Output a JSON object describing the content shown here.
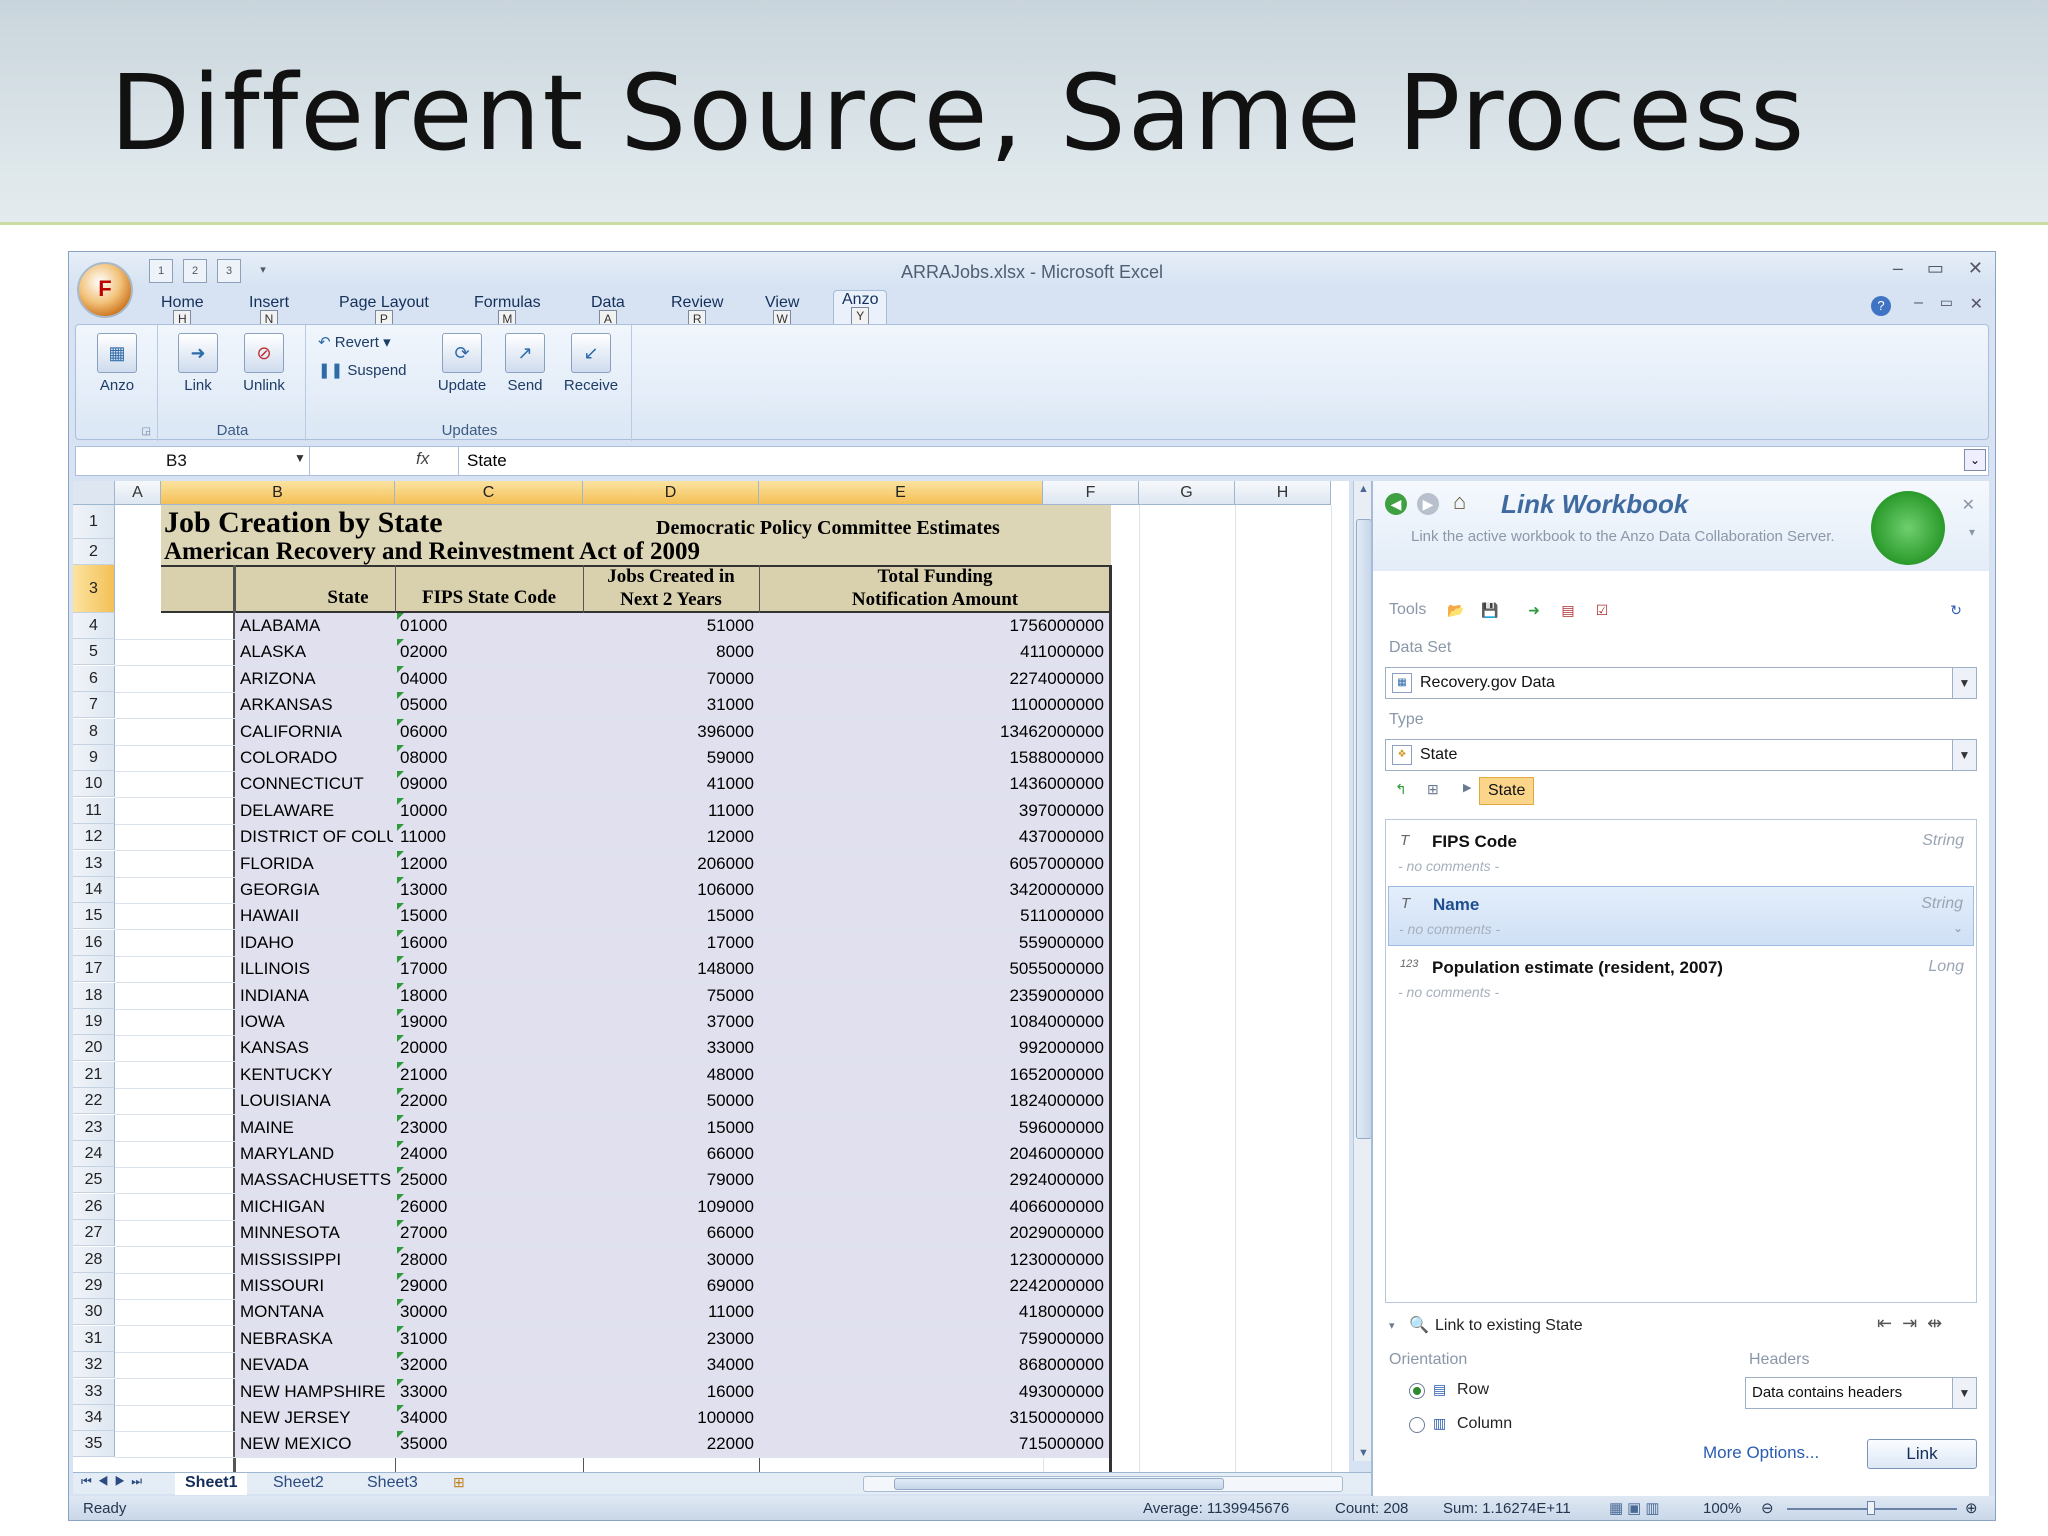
{
  "slide": {
    "title": "Different Source, Same Process"
  },
  "window": {
    "title": "ARRAJobs.xlsx - Microsoft Excel",
    "office_button": "F"
  },
  "qat": {
    "k1": "1",
    "k2": "2",
    "k3": "3"
  },
  "tabs": [
    {
      "label": "Home",
      "key": "H"
    },
    {
      "label": "Insert",
      "key": "N"
    },
    {
      "label": "Page Layout",
      "key": "P"
    },
    {
      "label": "Formulas",
      "key": "M"
    },
    {
      "label": "Data",
      "key": "A"
    },
    {
      "label": "Review",
      "key": "R"
    },
    {
      "label": "View",
      "key": "W"
    },
    {
      "label": "Anzo",
      "key": "Y"
    }
  ],
  "ribbon": {
    "anzo": "Anzo",
    "link": "Link",
    "unlink": "Unlink",
    "data_group": "Data",
    "revert": "Revert",
    "suspend": "Suspend",
    "update": "Update",
    "send": "Send",
    "receive": "Receive",
    "updates_group": "Updates"
  },
  "formula": {
    "namebox": "B3",
    "fx": "fx",
    "value": "State"
  },
  "columns": [
    "A",
    "B",
    "C",
    "D",
    "E",
    "F",
    "G",
    "H"
  ],
  "sheet": {
    "title": "Job Creation by State",
    "subtitle_right": "Democratic Policy Committee Estimates",
    "act": "American Recovery and Reinvestment Act of 2009",
    "headers": {
      "state": "State",
      "fips": "FIPS State Code",
      "jobs1": "Jobs Created in",
      "jobs2": "Next 2 Years",
      "fund1": "Total Funding",
      "fund2": "Notification Amount"
    },
    "rows": [
      {
        "n": "4",
        "state": "ALABAMA",
        "fips": "01000",
        "jobs": "51000",
        "fund": "1756000000"
      },
      {
        "n": "5",
        "state": "ALASKA",
        "fips": "02000",
        "jobs": "8000",
        "fund": "411000000"
      },
      {
        "n": "6",
        "state": "ARIZONA",
        "fips": "04000",
        "jobs": "70000",
        "fund": "2274000000"
      },
      {
        "n": "7",
        "state": "ARKANSAS",
        "fips": "05000",
        "jobs": "31000",
        "fund": "1100000000"
      },
      {
        "n": "8",
        "state": "CALIFORNIA",
        "fips": "06000",
        "jobs": "396000",
        "fund": "13462000000"
      },
      {
        "n": "9",
        "state": "COLORADO",
        "fips": "08000",
        "jobs": "59000",
        "fund": "1588000000"
      },
      {
        "n": "10",
        "state": "CONNECTICUT",
        "fips": "09000",
        "jobs": "41000",
        "fund": "1436000000"
      },
      {
        "n": "11",
        "state": "DELAWARE",
        "fips": "10000",
        "jobs": "11000",
        "fund": "397000000"
      },
      {
        "n": "12",
        "state": "DISTRICT OF COLUMBIA",
        "fips": "11000",
        "jobs": "12000",
        "fund": "437000000"
      },
      {
        "n": "13",
        "state": "FLORIDA",
        "fips": "12000",
        "jobs": "206000",
        "fund": "6057000000"
      },
      {
        "n": "14",
        "state": "GEORGIA",
        "fips": "13000",
        "jobs": "106000",
        "fund": "3420000000"
      },
      {
        "n": "15",
        "state": "HAWAII",
        "fips": "15000",
        "jobs": "15000",
        "fund": "511000000"
      },
      {
        "n": "16",
        "state": "IDAHO",
        "fips": "16000",
        "jobs": "17000",
        "fund": "559000000"
      },
      {
        "n": "17",
        "state": "ILLINOIS",
        "fips": "17000",
        "jobs": "148000",
        "fund": "5055000000"
      },
      {
        "n": "18",
        "state": "INDIANA",
        "fips": "18000",
        "jobs": "75000",
        "fund": "2359000000"
      },
      {
        "n": "19",
        "state": "IOWA",
        "fips": "19000",
        "jobs": "37000",
        "fund": "1084000000"
      },
      {
        "n": "20",
        "state": "KANSAS",
        "fips": "20000",
        "jobs": "33000",
        "fund": "992000000"
      },
      {
        "n": "21",
        "state": "KENTUCKY",
        "fips": "21000",
        "jobs": "48000",
        "fund": "1652000000"
      },
      {
        "n": "22",
        "state": "LOUISIANA",
        "fips": "22000",
        "jobs": "50000",
        "fund": "1824000000"
      },
      {
        "n": "23",
        "state": "MAINE",
        "fips": "23000",
        "jobs": "15000",
        "fund": "596000000"
      },
      {
        "n": "24",
        "state": "MARYLAND",
        "fips": "24000",
        "jobs": "66000",
        "fund": "2046000000"
      },
      {
        "n": "25",
        "state": "MASSACHUSETTS",
        "fips": "25000",
        "jobs": "79000",
        "fund": "2924000000"
      },
      {
        "n": "26",
        "state": "MICHIGAN",
        "fips": "26000",
        "jobs": "109000",
        "fund": "4066000000"
      },
      {
        "n": "27",
        "state": "MINNESOTA",
        "fips": "27000",
        "jobs": "66000",
        "fund": "2029000000"
      },
      {
        "n": "28",
        "state": "MISSISSIPPI",
        "fips": "28000",
        "jobs": "30000",
        "fund": "1230000000"
      },
      {
        "n": "29",
        "state": "MISSOURI",
        "fips": "29000",
        "jobs": "69000",
        "fund": "2242000000"
      },
      {
        "n": "30",
        "state": "MONTANA",
        "fips": "30000",
        "jobs": "11000",
        "fund": "418000000"
      },
      {
        "n": "31",
        "state": "NEBRASKA",
        "fips": "31000",
        "jobs": "23000",
        "fund": "759000000"
      },
      {
        "n": "32",
        "state": "NEVADA",
        "fips": "32000",
        "jobs": "34000",
        "fund": "868000000"
      },
      {
        "n": "33",
        "state": "NEW HAMPSHIRE",
        "fips": "33000",
        "jobs": "16000",
        "fund": "493000000"
      },
      {
        "n": "34",
        "state": "NEW JERSEY",
        "fips": "34000",
        "jobs": "100000",
        "fund": "3150000000"
      },
      {
        "n": "35",
        "state": "NEW MEXICO",
        "fips": "35000",
        "jobs": "22000",
        "fund": "715000000"
      }
    ]
  },
  "sheets": [
    "Sheet1",
    "Sheet2",
    "Sheet3"
  ],
  "status": {
    "ready": "Ready",
    "average": "Average: 1139945676",
    "count": "Count: 208",
    "sum": "Sum: 1.16274E+11",
    "zoom": "100%"
  },
  "pane": {
    "title": "Link Workbook",
    "desc": "Link the active workbook to the Anzo Data Collaboration Server.",
    "tools_label": "Tools",
    "dataset_label": "Data Set",
    "dataset_value": "Recovery.gov Data",
    "type_label": "Type",
    "type_value": "State",
    "crumb": "State",
    "props": [
      {
        "name": "FIPS Code",
        "type": "String",
        "comment": "- no comments -",
        "icon": "T"
      },
      {
        "name": "Name",
        "type": "String",
        "comment": "- no comments -",
        "icon": "T"
      },
      {
        "name": "Population estimate (resident, 2007)",
        "type": "Long",
        "comment": "- no comments -",
        "icon": "123"
      }
    ],
    "link_existing": "Link to existing State",
    "orientation_label": "Orientation",
    "orient_row": "Row",
    "orient_col": "Column",
    "headers_label": "Headers",
    "headers_value": "Data contains headers",
    "more": "More Options...",
    "link_btn": "Link"
  },
  "colors": {
    "accent": "#f4c056",
    "selected_header": "#fbe3a0",
    "header_band": "#d9d1ad",
    "grid_border": "#9eb6ce"
  }
}
